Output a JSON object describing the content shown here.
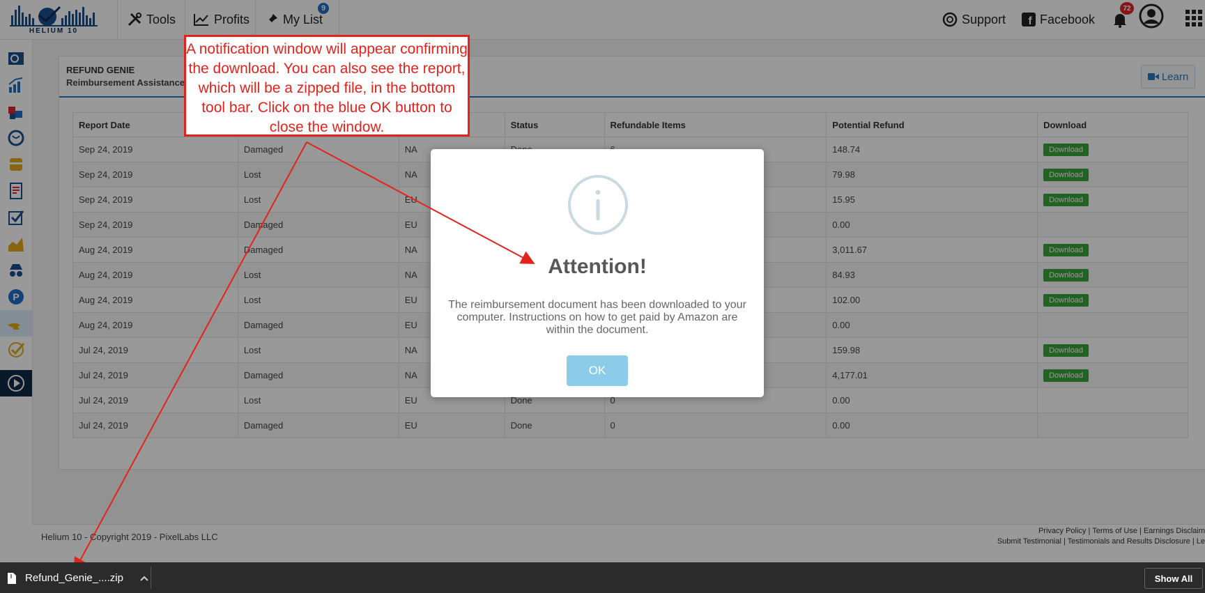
{
  "brand": {
    "logo_text": "HELIUM 10"
  },
  "nav": {
    "tools": "Tools",
    "profits": "Profits",
    "my_list": "My List",
    "my_list_badge": "9",
    "support": "Support",
    "facebook": "Facebook",
    "notifications_badge": "72"
  },
  "panel": {
    "title": "REFUND GENIE",
    "subtitle": "Reimbursement Assistance",
    "learn_label": "Learn"
  },
  "table": {
    "headers": [
      "Report Date",
      "",
      "",
      "Status",
      "Refundable Items",
      "Potential Refund",
      "Download"
    ],
    "download_label": "Download",
    "rows": [
      {
        "date": "Sep 24, 2019",
        "type": "Damaged",
        "region": "NA",
        "status": "Done",
        "items": "6",
        "refund": "148.74",
        "download": true
      },
      {
        "date": "Sep 24, 2019",
        "type": "Lost",
        "region": "NA",
        "status": "",
        "items": "",
        "refund": "79.98",
        "download": true
      },
      {
        "date": "Sep 24, 2019",
        "type": "Lost",
        "region": "EU",
        "status": "",
        "items": "",
        "refund": "15.95",
        "download": true
      },
      {
        "date": "Sep 24, 2019",
        "type": "Damaged",
        "region": "EU",
        "status": "",
        "items": "",
        "refund": "0.00",
        "download": false
      },
      {
        "date": "Aug 24, 2019",
        "type": "Damaged",
        "region": "NA",
        "status": "",
        "items": "",
        "refund": "3,011.67",
        "download": true
      },
      {
        "date": "Aug 24, 2019",
        "type": "Lost",
        "region": "NA",
        "status": "",
        "items": "",
        "refund": "84.93",
        "download": true
      },
      {
        "date": "Aug 24, 2019",
        "type": "Lost",
        "region": "EU",
        "status": "",
        "items": "",
        "refund": "102.00",
        "download": true
      },
      {
        "date": "Aug 24, 2019",
        "type": "Damaged",
        "region": "EU",
        "status": "",
        "items": "",
        "refund": "0.00",
        "download": false
      },
      {
        "date": "Jul 24, 2019",
        "type": "Lost",
        "region": "NA",
        "status": "",
        "items": "",
        "refund": "159.98",
        "download": true
      },
      {
        "date": "Jul 24, 2019",
        "type": "Damaged",
        "region": "NA",
        "status": "",
        "items": "",
        "refund": "4,177.01",
        "download": true
      },
      {
        "date": "Jul 24, 2019",
        "type": "Lost",
        "region": "EU",
        "status": "Done",
        "items": "0",
        "refund": "0.00",
        "download": false
      },
      {
        "date": "Jul 24, 2019",
        "type": "Damaged",
        "region": "EU",
        "status": "Done",
        "items": "0",
        "refund": "0.00",
        "download": false
      }
    ]
  },
  "modal": {
    "icon": "info-icon",
    "title": "Attention!",
    "text": "The reimbursement document has been downloaded to your computer. Instructions on how to get paid by Amazon are within the document.",
    "ok_label": "OK"
  },
  "callout": {
    "text": "A notification window will appear confirming the download. You can also see the report, which will be a zipped file, in the bottom tool bar. Click on the blue OK button to close the window."
  },
  "footer": {
    "copyright": "Helium 10 - Copyright 2019 - PixelLabs LLC",
    "links_line1": "Privacy Policy | Terms of Use | Earnings Disclaim",
    "links_line2": "Submit Testimonial | Testimonials and Results Disclosure | Le"
  },
  "download_bar": {
    "file_name": "Refund_Genie_....zip",
    "show_all": "Show All"
  },
  "colors": {
    "accent": "#2a7ab8",
    "download_green": "#3aa33a",
    "ok_button": "#8ccce9",
    "callout_red": "#e3231b",
    "badge_red": "#d9262c",
    "badge_blue": "#1f6fc5"
  }
}
